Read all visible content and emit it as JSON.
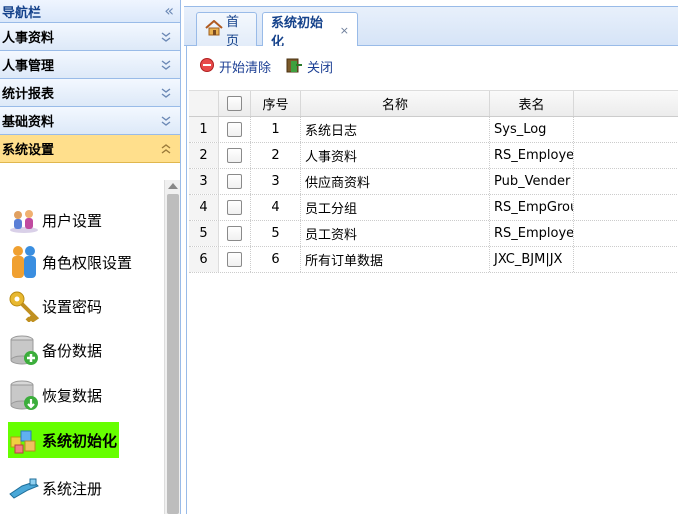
{
  "nav": {
    "title": "导航栏",
    "sections": [
      {
        "label": "人事资料"
      },
      {
        "label": "人事管理"
      },
      {
        "label": "统计报表"
      },
      {
        "label": "基础资料"
      },
      {
        "label": "系统设置"
      }
    ],
    "menu": [
      {
        "label": "用户设置",
        "icon": "users-icon"
      },
      {
        "label": "角色权限设置",
        "icon": "people-roles-icon"
      },
      {
        "label": "设置密码",
        "icon": "key-icon"
      },
      {
        "label": "备份数据",
        "icon": "database-add-icon"
      },
      {
        "label": "恢复数据",
        "icon": "database-restore-icon"
      },
      {
        "label": "系统初始化",
        "icon": "cubes-icon"
      },
      {
        "label": "系统注册",
        "icon": "register-tool-icon"
      }
    ]
  },
  "tabs": [
    {
      "label": "首页",
      "icon": "home-icon"
    },
    {
      "label": "系统初始化",
      "close": "×"
    }
  ],
  "toolbar": {
    "start_clear": "开始清除",
    "close": "关闭"
  },
  "grid": {
    "headers": {
      "no": "序号",
      "name": "名称",
      "table": "表名"
    },
    "rows": [
      {
        "rn": "1",
        "no": "1",
        "name": "系统日志",
        "table": "Sys_Log"
      },
      {
        "rn": "2",
        "no": "2",
        "name": "人事资料",
        "table": "RS_Employe"
      },
      {
        "rn": "3",
        "no": "3",
        "name": "供应商资料",
        "table": "Pub_Vender"
      },
      {
        "rn": "4",
        "no": "4",
        "name": "员工分组",
        "table": "RS_EmpGrou"
      },
      {
        "rn": "5",
        "no": "5",
        "name": "员工资料",
        "table": "RS_Employe"
      },
      {
        "rn": "6",
        "no": "6",
        "name": "所有订单数据",
        "table": "JXC_BJM|JX"
      }
    ]
  },
  "colors": {
    "accent": "#99bbe8",
    "active_section": "#ffdf8c",
    "selected_item": "#66ff00"
  }
}
